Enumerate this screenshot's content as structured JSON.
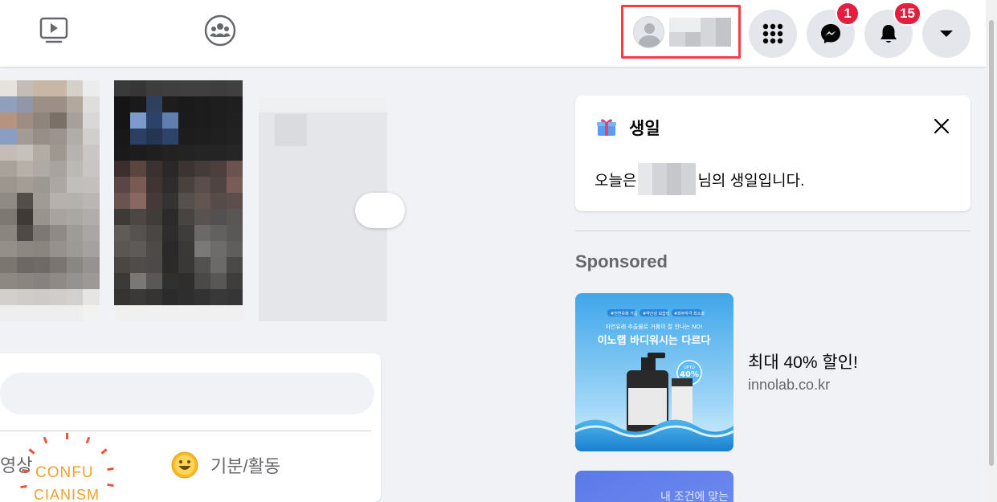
{
  "header": {
    "icons": [
      "watch-icon",
      "groups-icon",
      "menu-grid-icon",
      "messenger-icon",
      "bell-icon",
      "caret-down-icon"
    ],
    "messenger_badge": "1",
    "notifications_badge": "15",
    "highlight_color": "#f23d45",
    "badge_color": "#e41e3f"
  },
  "composer": {
    "video_label": "영상",
    "feeling_label": "기분/활동",
    "sticker_line1": "CONFU",
    "sticker_line2": "CIANISM"
  },
  "birthday": {
    "title": "생일",
    "text_prefix": "오늘은",
    "text_suffix": "님의 생일입니다."
  },
  "sponsored": {
    "heading": "Sponsored",
    "ads": [
      {
        "title": "최대 40% 할인!",
        "site": "innolab.co.kr",
        "image_tags": [
          "#천연유래 거품",
          "#약산성 보습력",
          "#피부자극 최소화"
        ],
        "image_line1": "자연유래 추출물로 거품이 잘 안나는 NO!",
        "image_headline": "이노랩 바디워시는 다르다",
        "image_badge_top": "UPTO",
        "image_badge_value": "40%"
      },
      {
        "image_text": "내 조건에 맞는"
      }
    ]
  }
}
